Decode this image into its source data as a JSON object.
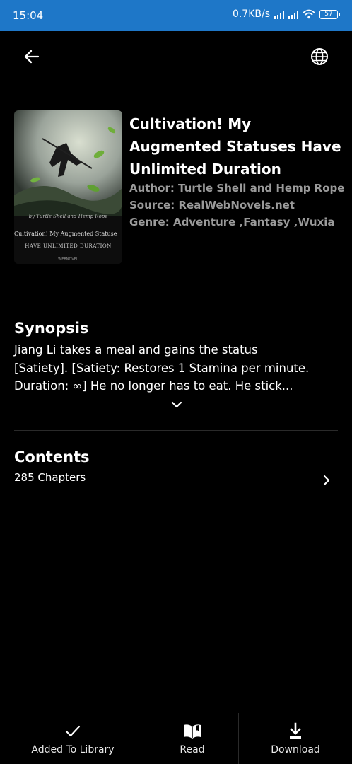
{
  "status_bar": {
    "time": "15:04",
    "network_speed": "0.7KB/s",
    "battery": "57"
  },
  "book": {
    "title": "Cultivation! My Augmented Statuses Have Unlimited Duration",
    "author_label": "Author: Turtle Shell and Hemp Rope",
    "source_label": "Source: RealWebNovels.net",
    "genre_label": "Genre: Adventure ,Fantasy ,Wuxia"
  },
  "cover": {
    "author_text": "by Turtle Shell and Hemp Rope",
    "title_text": "Cultivation! My Augmented Statuse",
    "subtitle_text": "HAVE UNLIMITED DURATION",
    "brand_text": "WEBNOVEL"
  },
  "synopsis": {
    "heading": "Synopsis",
    "lines": [
      "Jiang Li takes a meal and gains the status",
      "[Satiety]. [Satiety: Restores 1 Stamina per minute.",
      "Duration: ∞] He no longer has to eat. He stick..."
    ]
  },
  "contents": {
    "heading": "Contents",
    "chapters": "285 Chapters"
  },
  "bottom_bar": {
    "library_label": "Added To Library",
    "read_label": "Read",
    "download_label": "Download"
  },
  "icons": {
    "back": "arrow-left-icon",
    "language": "globe-icon",
    "expand": "chevron-down-icon",
    "open_contents": "chevron-right-icon",
    "library": "check-icon",
    "read": "book-open-icon",
    "download": "download-icon"
  },
  "colors": {
    "status_bar": "#1e77c8",
    "background": "#000000",
    "meta_text": "#9a9a9a",
    "divider": "#2a2a2a"
  }
}
